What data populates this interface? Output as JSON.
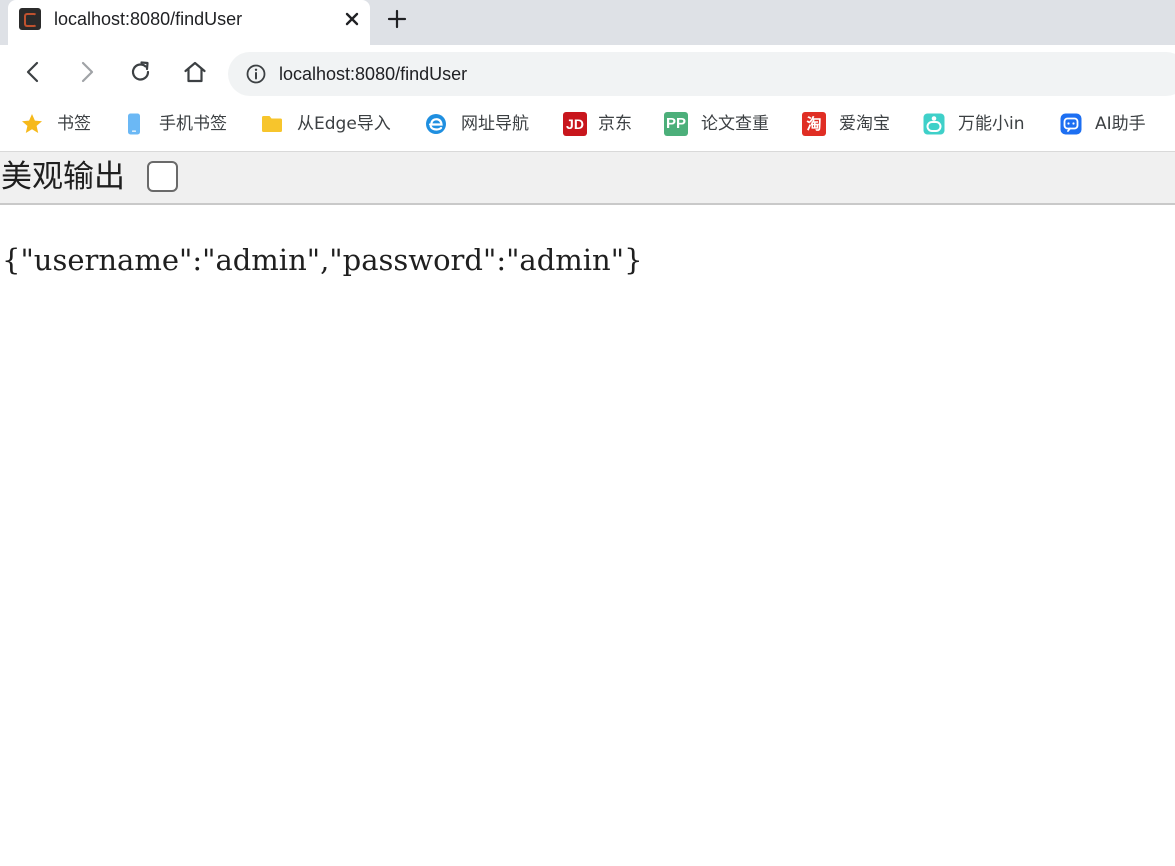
{
  "tab": {
    "title": "localhost:8080/findUser",
    "favicon": "app-icon"
  },
  "toolbar": {
    "url": "localhost:8080/findUser"
  },
  "bookmarks": [
    {
      "label": "书签",
      "icon": "star-icon"
    },
    {
      "label": "手机书签",
      "icon": "phone-icon"
    },
    {
      "label": "从Edge导入",
      "icon": "folder-icon"
    },
    {
      "label": "网址导航",
      "icon": "edge-icon"
    },
    {
      "label": "京东",
      "icon": "jd-icon",
      "mark": "JD"
    },
    {
      "label": "论文查重",
      "icon": "pp-icon",
      "mark": "PP"
    },
    {
      "label": "爱淘宝",
      "icon": "taobao-icon",
      "mark": "淘"
    },
    {
      "label": "万能小in",
      "icon": "xiaoin-icon"
    },
    {
      "label": "AI助手",
      "icon": "ai-assistant-icon"
    }
  ],
  "viewer": {
    "pretty_print_label": "美观输出",
    "pretty_print_checked": false
  },
  "json_output": "{\"username\":\"admin\",\"password\":\"admin\"}",
  "colors": {
    "tabstrip": "#dee1e6",
    "omnibox": "#f1f3f4",
    "viewer_bar": "#f0f0f0",
    "jd": "#c8161d",
    "pp": "#4caf7a",
    "taobao": "#e02e24"
  }
}
